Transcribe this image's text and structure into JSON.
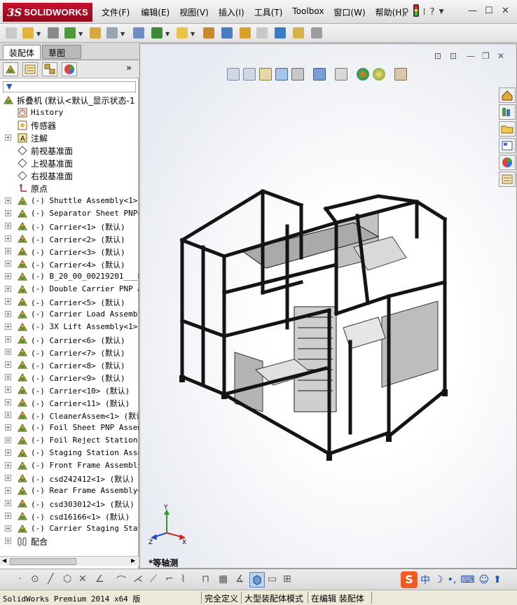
{
  "app": {
    "logo_ds": "3S",
    "logo_text": "SOLIDWORKS",
    "menus": [
      "文件(F)",
      "编辑(E)",
      "视图(V)",
      "插入(I)",
      "工具(T)",
      "Toolbox",
      "窗口(W)",
      "帮助(H)"
    ]
  },
  "tabs": {
    "assembly": "装配体",
    "sketch": "草图"
  },
  "tree": {
    "root": "拆叠机  (默认<默认_显示状态-1",
    "history": "History",
    "sensors": "传感器",
    "annotations": "注解",
    "front_plane": "前视基准面",
    "top_plane": "上视基准面",
    "right_plane": "右视基准面",
    "origin": "原点",
    "components": [
      "(-) Shuttle Assembly<1> (",
      "(-) Separator Sheet PNP<1",
      "(-) Carrier<1> (默认)",
      "(-) Carrier<2> (默认)",
      "(-) Carrier<3> (默认)",
      "(-) Carrier<4> (默认)",
      "(-) B_20_00_00219201___850",
      "(-) Double Carrier PNP As",
      "(-) Carrier<5> (默认)",
      "(-) Carrier Load Assembly",
      "(-) 3X Lift Assembly<1> (",
      "(-) Carrier<6> (默认)",
      "(-) Carrier<7> (默认)",
      "(-) Carrier<8> (默认)",
      "(-) Carrier<9> (默认)",
      "(-) Carrier<10> (默认)",
      "(-) Carrier<11> (默认)",
      "(-) CleanerAssem<1> (默认",
      "(-) Foil Sheet PNP Assemb",
      "(-) Foil Reject Station A",
      "(-) Staging Station Assem",
      "(-) Front Frame Assembly<",
      "(-) csd242412<1> (默认)",
      "(-) Rear Frame Assembly<1",
      "(-) csd303012<1> (默认)",
      "(-) csd16166<1> (默认)",
      "(-) Carrier Staging Stati"
    ],
    "mates": "配合"
  },
  "viewport": {
    "view_label": "*等轴测",
    "triad": {
      "x": "X",
      "y": "Y",
      "z": "Z"
    }
  },
  "ime": {
    "logo": "S",
    "lang": "中"
  },
  "status": {
    "version": "SolidWorks Premium 2014 x64 版",
    "defined": "完全定义",
    "mode": "大型装配体模式",
    "editing": "在编辑 装配体"
  },
  "colors": {
    "logo_red": "#c8102e",
    "frame_dark": "#1a1a1a",
    "panel_gray": "#b8b8b8"
  }
}
